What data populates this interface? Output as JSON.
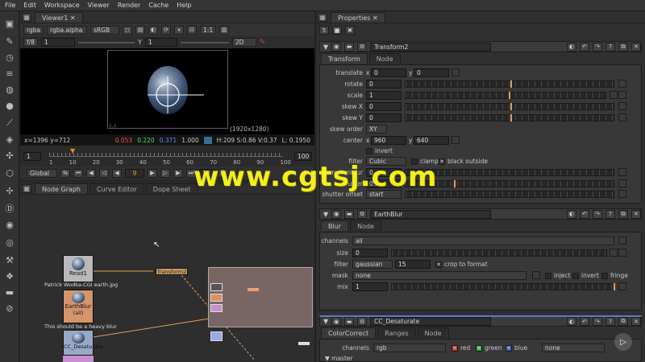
{
  "menu": [
    "File",
    "Edit",
    "Workspace",
    "Viewer",
    "Render",
    "Cache",
    "Help"
  ],
  "viewer": {
    "tab": "Viewer1",
    "channels": "rgba",
    "channel_alpha": "rgba.alpha",
    "colorspace": "sRGB",
    "zoom": "1:1",
    "fstop": "f/8",
    "gain": "1",
    "gamma_label": "Y",
    "gamma": "1",
    "mode": "2D",
    "coords": "x=1396 y=712",
    "pix_r": "0.053",
    "pix_g": "0.220",
    "pix_b": "0.371",
    "pix_a": "1.000",
    "hsv": "H:209 S:0.86 V:0.37",
    "lum": "L: 0.1950",
    "resolution": "(1920x1280)",
    "corner_label": "1,1"
  },
  "timeline": {
    "ticks": [
      "1",
      "10",
      "20",
      "30",
      "40",
      "50",
      "60",
      "70",
      "80",
      "90",
      "100"
    ],
    "start": "1",
    "end": "100",
    "current_frame": "9",
    "increment": "10",
    "scope": "Global"
  },
  "node_graph": {
    "tabs": [
      "Node Graph",
      "Curve Editor",
      "Dope Sheet"
    ],
    "nodes": [
      {
        "name": "Read1",
        "label": "Patrick Wodka-CGI earth.jpg",
        "color": "#b9b9b9"
      },
      {
        "name": "EarthBlur",
        "sub": "(all)",
        "label": "This should be a heavy blur",
        "color": "#d4956a"
      },
      {
        "name": "CC_Desaturate",
        "color": "#9aa8c8"
      },
      {
        "name": "Transform2",
        "color": "#c99a63"
      }
    ]
  },
  "properties": {
    "title": "Properties",
    "transform_node": {
      "name": "Transform2",
      "tabs": [
        "Transform",
        "Node"
      ],
      "translate_label": "translate",
      "translate_x": "0",
      "translate_y": "0",
      "rotate_label": "rotate",
      "rotate": "0",
      "scale_label": "scale",
      "scale": "1",
      "skew_x_label": "skew X",
      "skew_x": "0",
      "skew_y_label": "skew Y",
      "skew_y": "0",
      "skew_order_label": "skew order",
      "skew_order": "XY",
      "center_label": "center",
      "center_x": "960",
      "center_y": "640",
      "invert_label": "invert",
      "filter_label": "filter",
      "filter": "Cubic",
      "clamp_label": "clamp",
      "black_outside_label": "black outside",
      "motionblur_label": "motionblur",
      "motionblur": "0",
      "shutter_label": "shutter",
      "shutter": "0.5",
      "shutter_offset_label": "shutter offset",
      "shutter_offset": "start"
    },
    "blur_node": {
      "name": "EarthBlur",
      "tabs": [
        "Blur",
        "Node"
      ],
      "channels_label": "channels",
      "channels": "all",
      "size_label": "size",
      "size": "0",
      "filter_label": "filter",
      "filter": "gaussian",
      "filter_quality": "15",
      "crop_label": "crop to format",
      "mask_label": "mask",
      "mask": "none",
      "inject_label": "inject",
      "invert_label": "invert",
      "fringe_label": "fringe",
      "mix_label": "mix",
      "mix": "1"
    },
    "cc_node": {
      "name": "CC_Desaturate",
      "tabs": [
        "ColorCorrect",
        "Ranges",
        "Node"
      ],
      "channels_label": "channels",
      "channels": "rgb",
      "red_label": "red",
      "green_label": "green",
      "blue_label": "blue",
      "mask": "none",
      "master_label": "master"
    }
  },
  "watermark": "www.cgtsj.com",
  "colors": {
    "accent": "#e0a060",
    "watermark": "#f4ee1c"
  }
}
